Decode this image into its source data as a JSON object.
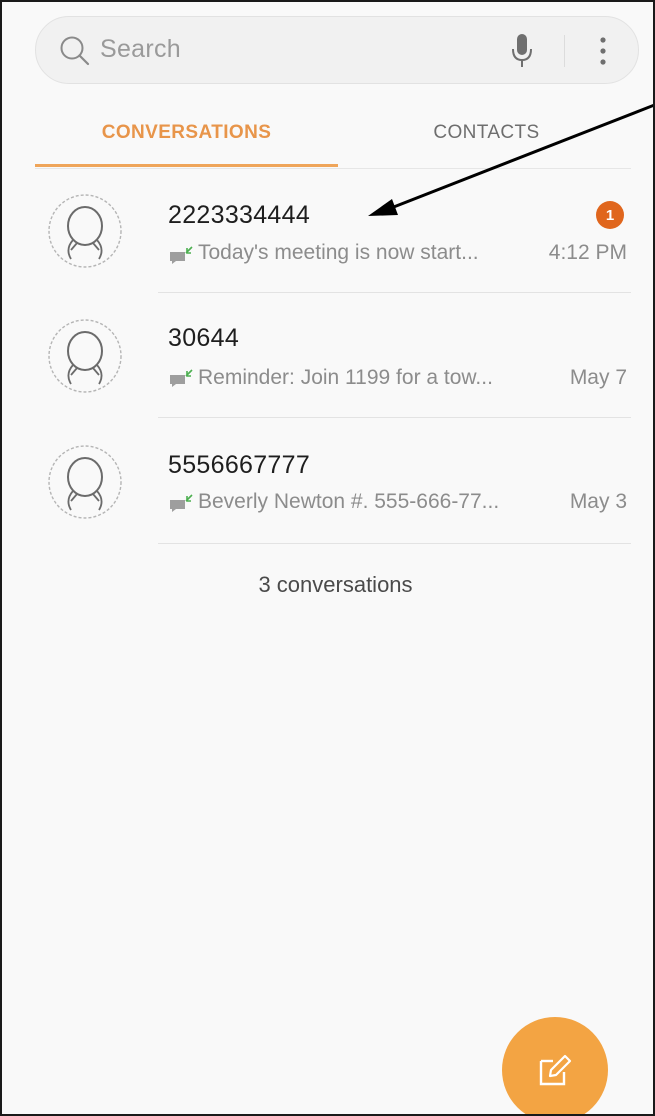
{
  "search": {
    "placeholder": "Search"
  },
  "tabs": [
    {
      "label": "CONVERSATIONS",
      "active": true
    },
    {
      "label": "CONTACTS",
      "active": false
    }
  ],
  "conversations": [
    {
      "sender": "2223334444",
      "snippet": "Today's meeting is now start...",
      "time": "4:12 PM",
      "unread": "1"
    },
    {
      "sender": "30644",
      "snippet": "Reminder: Join 1199 for a tow...",
      "time": "May 7"
    },
    {
      "sender": "5556667777",
      "snippet": "Beverly Newton #. 555-666-77...",
      "time": "May 3"
    }
  ],
  "footer": {
    "count_text": "3 conversations"
  },
  "colors": {
    "accent": "#e8954a",
    "fab": "#f3a443",
    "badge": "#e0661d",
    "snippet_icon": "#9e9e9e",
    "snippet_icon_arrow": "#4caf50"
  },
  "icons": {
    "search": "search-icon",
    "mic": "microphone-icon",
    "more": "more-vertical-icon",
    "avatar": "person-avatar-icon",
    "message": "message-icon",
    "compose": "compose-icon"
  }
}
